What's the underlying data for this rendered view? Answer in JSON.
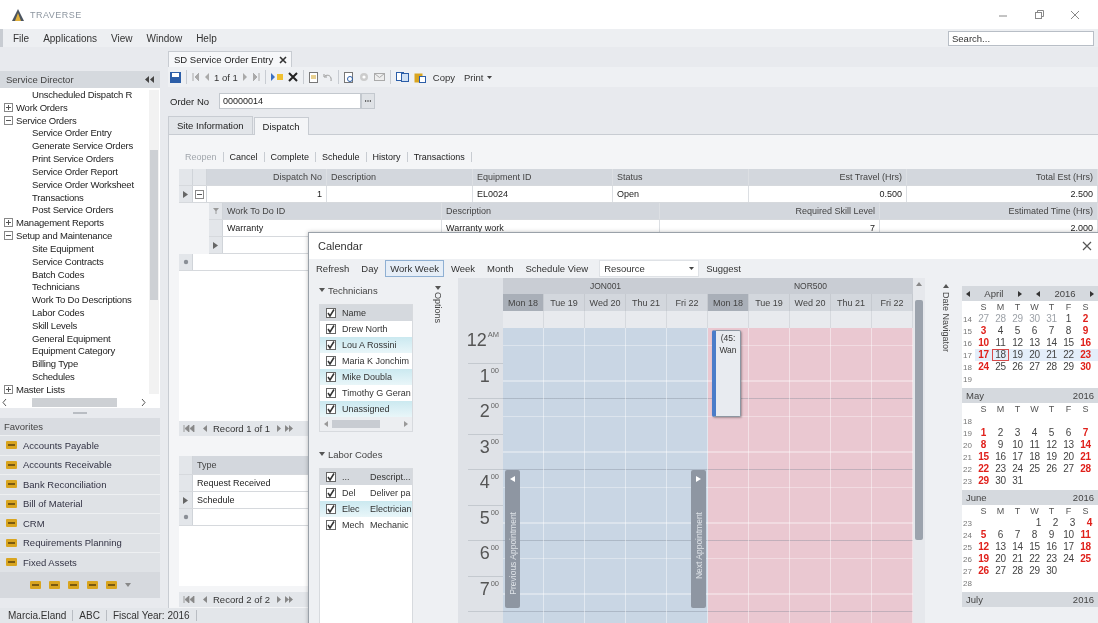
{
  "app": {
    "title": "TRAVERSE"
  },
  "menu": [
    "File",
    "Applications",
    "View",
    "Window",
    "Help"
  ],
  "search": {
    "placeholder": "Search..."
  },
  "sidebar": {
    "title": "Service Director",
    "tree": [
      {
        "label": "Unscheduled Dispatch R",
        "kind": "leaf"
      },
      {
        "label": "Work Orders",
        "kind": "node",
        "expanded": false
      },
      {
        "label": "Service Orders",
        "kind": "node",
        "expanded": true,
        "children": [
          {
            "label": "Service Order Entry",
            "kind": "leaf"
          },
          {
            "label": "Generate Service Orders",
            "kind": "leaf"
          },
          {
            "label": "Print Service Orders",
            "kind": "leaf"
          },
          {
            "label": "Service Order Report",
            "kind": "leaf"
          },
          {
            "label": "Service Order Worksheet",
            "kind": "leaf"
          },
          {
            "label": "Transactions",
            "kind": "leaf"
          },
          {
            "label": "Post Service Orders",
            "kind": "leaf"
          }
        ]
      },
      {
        "label": "Management Reports",
        "kind": "node",
        "expanded": false
      },
      {
        "label": "Setup and Maintenance",
        "kind": "node",
        "expanded": true,
        "children": [
          {
            "label": "Site Equipment",
            "kind": "leaf"
          },
          {
            "label": "Service Contracts",
            "kind": "leaf"
          },
          {
            "label": "Batch Codes",
            "kind": "leaf"
          },
          {
            "label": "Technicians",
            "kind": "leaf"
          },
          {
            "label": "Work To Do Descriptions",
            "kind": "leaf"
          },
          {
            "label": "Labor Codes",
            "kind": "leaf"
          },
          {
            "label": "Skill Levels",
            "kind": "leaf"
          },
          {
            "label": "General Equipment",
            "kind": "leaf"
          },
          {
            "label": "Equipment Category",
            "kind": "leaf"
          },
          {
            "label": "Billing Type",
            "kind": "leaf"
          },
          {
            "label": "Schedules",
            "kind": "leaf"
          }
        ]
      },
      {
        "label": "Master Lists",
        "kind": "node",
        "expanded": false
      }
    ],
    "favorites_title": "Favorites",
    "favorites": [
      "Accounts Payable",
      "Accounts Receivable",
      "Bank Reconciliation",
      "Bill of Material",
      "CRM",
      "Requirements Planning",
      "Fixed Assets"
    ]
  },
  "document_tab": {
    "label": "SD Service Order Entry"
  },
  "toolbar": {
    "record": "1 of 1",
    "copy": "Copy",
    "print": "Print"
  },
  "order": {
    "label": "Order No",
    "value": "00000014"
  },
  "tabs": [
    {
      "label": "Site Information",
      "selected": false
    },
    {
      "label": "Dispatch",
      "selected": true
    }
  ],
  "actions": [
    {
      "label": "Reopen",
      "disabled": true
    },
    {
      "label": "Cancel",
      "disabled": false
    },
    {
      "label": "Complete",
      "disabled": false
    },
    {
      "label": "Schedule",
      "disabled": false
    },
    {
      "label": "History",
      "disabled": false
    },
    {
      "label": "Transactions",
      "disabled": false
    }
  ],
  "dispatch_grid": {
    "columns": [
      "Dispatch No",
      "Description",
      "Equipment ID",
      "Status",
      "Est Travel (Hrs)",
      "Total Est (Hrs)"
    ],
    "rows": [
      {
        "current": true,
        "expanded": true,
        "cells": [
          "1",
          null,
          "EL0024",
          "Open",
          "0.500",
          "2.500"
        ]
      }
    ]
  },
  "work_grid": {
    "columns": [
      "Work To Do ID",
      "Description",
      "Required Skill Level",
      "Estimated Time (Hrs)"
    ],
    "rows": [
      {
        "current": false,
        "cells": [
          "Warranty",
          "Warranty work",
          "7",
          "2.000"
        ]
      }
    ],
    "entry_row_current": true
  },
  "record_nav_top": "Record 1 of 1",
  "type_grid": {
    "column": "Type",
    "rows": [
      {
        "text": "Request Received",
        "current": false
      },
      {
        "text": "Schedule",
        "current": true
      }
    ]
  },
  "record_nav_bottom": "Record 2 of 2",
  "status_bar": [
    "Marcia.Eland",
    "ABC",
    "Fiscal Year: 2016"
  ],
  "calendar": {
    "title": "Calendar",
    "views": [
      {
        "label": "Refresh",
        "selected": false
      },
      {
        "label": "Day",
        "selected": false
      },
      {
        "label": "Work Week",
        "selected": true
      },
      {
        "label": "Week",
        "selected": false
      },
      {
        "label": "Month",
        "selected": false
      },
      {
        "label": "Schedule View",
        "selected": false
      }
    ],
    "resource_select": "Resource",
    "suggest": "Suggest",
    "technicians": {
      "title": "Technicians",
      "header": "Name",
      "header_checked": true,
      "rows": [
        {
          "name": "Drew North",
          "checked": true,
          "selected": false
        },
        {
          "name": "Lou A Rossini",
          "checked": true,
          "selected": true
        },
        {
          "name": "Maria K Jonchim",
          "checked": true,
          "selected": false
        },
        {
          "name": "Mike Doubla",
          "checked": true,
          "selected": true
        },
        {
          "name": "Timothy G Geran",
          "checked": true,
          "selected": false
        },
        {
          "name": "Unassigned",
          "checked": true,
          "selected": true
        }
      ]
    },
    "labor_codes": {
      "title": "Labor Codes",
      "header_code": "...",
      "header_description": "Descript...",
      "header_checked": true,
      "rows": [
        {
          "code": "Del",
          "description": "Deliver pa",
          "checked": true,
          "selected": false
        },
        {
          "code": "Elec",
          "description": "Electrician",
          "checked": true,
          "selected": true
        },
        {
          "code": "Mech",
          "description": "Mechanic",
          "checked": true,
          "selected": false
        }
      ]
    },
    "options_label": "Options",
    "resources": [
      {
        "name": "JON001",
        "color": "#c9d6e4",
        "days": [
          {
            "label": "Mon 18",
            "selected": true
          },
          {
            "label": "Tue 19",
            "selected": false
          },
          {
            "label": "Wed 20",
            "selected": false
          },
          {
            "label": "Thu 21",
            "selected": false
          },
          {
            "label": "Fri 22",
            "selected": false
          }
        ]
      },
      {
        "name": "NOR500",
        "color": "#eac8d1",
        "days": [
          {
            "label": "Mon 18",
            "selected": true,
            "appointment": {
              "lines": [
                "(45:",
                "Wan"
              ]
            }
          },
          {
            "label": "Tue 19",
            "selected": false
          },
          {
            "label": "Wed 20",
            "selected": false
          },
          {
            "label": "Thu 21",
            "selected": false
          },
          {
            "label": "Fri 22",
            "selected": false
          }
        ]
      }
    ],
    "hours": [
      {
        "hour": "12",
        "suffix": "AM"
      },
      {
        "hour": "1",
        "suffix": "00"
      },
      {
        "hour": "2",
        "suffix": "00"
      },
      {
        "hour": "3",
        "suffix": "00"
      },
      {
        "hour": "4",
        "suffix": "00"
      },
      {
        "hour": "5",
        "suffix": "00"
      },
      {
        "hour": "6",
        "suffix": "00"
      },
      {
        "hour": "7",
        "suffix": "00"
      }
    ],
    "prev_label": "Previous Appointment",
    "next_label": "Next Appointment",
    "navigator_label": "Date Navigator",
    "months": [
      {
        "name": "April",
        "year": "2016",
        "kind": "nav",
        "weekdays": [
          "S",
          "M",
          "T",
          "W",
          "T",
          "F",
          "S"
        ],
        "weeks": [
          {
            "number": "14",
            "kind": "start",
            "highlighted": false,
            "days": [
              {
                "t": "27",
                "kind": "other",
                "selected": false
              },
              {
                "t": "28",
                "kind": "other",
                "selected": false
              },
              {
                "t": "29",
                "kind": "other",
                "selected": false
              },
              {
                "t": "30",
                "kind": "other",
                "selected": false
              },
              {
                "t": "31",
                "kind": "other",
                "selected": false
              },
              {
                "t": "1",
                "kind": "weekday",
                "selected": false
              },
              {
                "t": "2",
                "kind": "weekend",
                "selected": false
              }
            ]
          },
          {
            "number": "15",
            "kind": "start",
            "highlighted": false,
            "days": [
              {
                "t": "3",
                "kind": "weekend",
                "selected": false
              },
              {
                "t": "4",
                "kind": "weekday",
                "selected": false
              },
              {
                "t": "5",
                "kind": "weekday",
                "selected": false
              },
              {
                "t": "6",
                "kind": "weekday",
                "selected": false
              },
              {
                "t": "7",
                "kind": "weekday",
                "selected": false
              },
              {
                "t": "8",
                "kind": "weekday",
                "selected": false
              },
              {
                "t": "9",
                "kind": "weekend",
                "selected": false
              }
            ]
          },
          {
            "number": "16",
            "kind": "start",
            "highlighted": false,
            "days": [
              {
                "t": "10",
                "kind": "weekend",
                "selected": false
              },
              {
                "t": "11",
                "kind": "weekday",
                "selected": false
              },
              {
                "t": "12",
                "kind": "weekday",
                "selected": false
              },
              {
                "t": "13",
                "kind": "weekday",
                "selected": false
              },
              {
                "t": "14",
                "kind": "weekday",
                "selected": false
              },
              {
                "t": "15",
                "kind": "weekday",
                "selected": false
              },
              {
                "t": "16",
                "kind": "weekend",
                "selected": false
              }
            ]
          },
          {
            "number": "17",
            "kind": "start",
            "highlighted": true,
            "days": [
              {
                "t": "17",
                "kind": "weekend",
                "selected": false
              },
              {
                "t": "18",
                "kind": "weekday",
                "selected": true
              },
              {
                "t": "19",
                "kind": "weekday",
                "selected": false
              },
              {
                "t": "20",
                "kind": "weekday",
                "selected": false
              },
              {
                "t": "21",
                "kind": "weekday",
                "selected": false
              },
              {
                "t": "22",
                "kind": "weekday",
                "selected": false
              },
              {
                "t": "23",
                "kind": "weekend",
                "selected": false
              }
            ]
          },
          {
            "number": "18",
            "kind": "start",
            "highlighted": false,
            "days": [
              {
                "t": "24",
                "kind": "weekend",
                "selected": false
              },
              {
                "t": "25",
                "kind": "weekday",
                "selected": false
              },
              {
                "t": "26",
                "kind": "weekday",
                "selected": false
              },
              {
                "t": "27",
                "kind": "weekday",
                "selected": false
              },
              {
                "t": "28",
                "kind": "weekday",
                "selected": false
              },
              {
                "t": "29",
                "kind": "weekday",
                "selected": false
              },
              {
                "t": "30",
                "kind": "weekend",
                "selected": false
              }
            ]
          },
          {
            "number": "19",
            "kind": "start",
            "highlighted": false
          }
        ]
      },
      {
        "name": "May",
        "year": "2016",
        "kind": "plain",
        "weekdays": [
          "S",
          "M",
          "T",
          "W",
          "T",
          "F",
          "S"
        ],
        "weeks": [
          {
            "number": "18",
            "kind": "start",
            "highlighted": false
          },
          {
            "number": "19",
            "kind": "start",
            "highlighted": false,
            "days": [
              {
                "t": "1",
                "kind": "weekend",
                "selected": false
              },
              {
                "t": "2",
                "kind": "weekday",
                "selected": false
              },
              {
                "t": "3",
                "kind": "weekday",
                "selected": false
              },
              {
                "t": "4",
                "kind": "weekday",
                "selected": false
              },
              {
                "t": "5",
                "kind": "weekday",
                "selected": false
              },
              {
                "t": "6",
                "kind": "weekday",
                "selected": false
              },
              {
                "t": "7",
                "kind": "weekend",
                "selected": false
              }
            ]
          },
          {
            "number": "20",
            "kind": "start",
            "highlighted": false,
            "days": [
              {
                "t": "8",
                "kind": "weekend",
                "selected": false
              },
              {
                "t": "9",
                "kind": "weekday",
                "selected": false
              },
              {
                "t": "10",
                "kind": "weekday",
                "selected": false
              },
              {
                "t": "11",
                "kind": "weekday",
                "selected": false
              },
              {
                "t": "12",
                "kind": "weekday",
                "selected": false
              },
              {
                "t": "13",
                "kind": "weekday",
                "selected": false
              },
              {
                "t": "14",
                "kind": "weekend",
                "selected": false
              }
            ]
          },
          {
            "number": "21",
            "kind": "start",
            "highlighted": false,
            "days": [
              {
                "t": "15",
                "kind": "weekend",
                "selected": false
              },
              {
                "t": "16",
                "kind": "weekday",
                "selected": false
              },
              {
                "t": "17",
                "kind": "weekday",
                "selected": false
              },
              {
                "t": "18",
                "kind": "weekday",
                "selected": false
              },
              {
                "t": "19",
                "kind": "weekday",
                "selected": false
              },
              {
                "t": "20",
                "kind": "weekday",
                "selected": false
              },
              {
                "t": "21",
                "kind": "weekend",
                "selected": false
              }
            ]
          },
          {
            "number": "22",
            "kind": "start",
            "highlighted": false,
            "days": [
              {
                "t": "22",
                "kind": "weekend",
                "selected": false
              },
              {
                "t": "23",
                "kind": "weekday",
                "selected": false
              },
              {
                "t": "24",
                "kind": "weekday",
                "selected": false
              },
              {
                "t": "25",
                "kind": "weekday",
                "selected": false
              },
              {
                "t": "26",
                "kind": "weekday",
                "selected": false
              },
              {
                "t": "27",
                "kind": "weekday",
                "selected": false
              },
              {
                "t": "28",
                "kind": "weekend",
                "selected": false
              }
            ]
          },
          {
            "number": "23",
            "kind": "start",
            "highlighted": false,
            "days": [
              {
                "t": "29",
                "kind": "weekend",
                "selected": false
              },
              {
                "t": "30",
                "kind": "weekday",
                "selected": false
              },
              {
                "t": "31",
                "kind": "weekday",
                "selected": false
              }
            ]
          }
        ]
      },
      {
        "name": "June",
        "year": "2016",
        "kind": "plain",
        "weekdays": [
          "S",
          "M",
          "T",
          "W",
          "T",
          "F",
          "S"
        ],
        "weeks": [
          {
            "number": "23",
            "kind": "end",
            "highlighted": false,
            "days": [
              {
                "t": "1",
                "kind": "weekday",
                "selected": false
              },
              {
                "t": "2",
                "kind": "weekday",
                "selected": false
              },
              {
                "t": "3",
                "kind": "weekday",
                "selected": false
              },
              {
                "t": "4",
                "kind": "weekend",
                "selected": false
              }
            ]
          },
          {
            "number": "24",
            "kind": "start",
            "highlighted": false,
            "days": [
              {
                "t": "5",
                "kind": "weekend",
                "selected": false
              },
              {
                "t": "6",
                "kind": "weekday",
                "selected": false
              },
              {
                "t": "7",
                "kind": "weekday",
                "selected": false
              },
              {
                "t": "8",
                "kind": "weekday",
                "selected": false
              },
              {
                "t": "9",
                "kind": "weekday",
                "selected": false
              },
              {
                "t": "10",
                "kind": "weekday",
                "selected": false
              },
              {
                "t": "11",
                "kind": "weekend",
                "selected": false
              }
            ]
          },
          {
            "number": "25",
            "kind": "start",
            "highlighted": false,
            "days": [
              {
                "t": "12",
                "kind": "weekend",
                "selected": false
              },
              {
                "t": "13",
                "kind": "weekday",
                "selected": false
              },
              {
                "t": "14",
                "kind": "weekday",
                "selected": false
              },
              {
                "t": "15",
                "kind": "weekday",
                "selected": false
              },
              {
                "t": "16",
                "kind": "weekday",
                "selected": false
              },
              {
                "t": "17",
                "kind": "weekday",
                "selected": false
              },
              {
                "t": "18",
                "kind": "weekend",
                "selected": false
              }
            ]
          },
          {
            "number": "26",
            "kind": "start",
            "highlighted": false,
            "days": [
              {
                "t": "19",
                "kind": "weekend",
                "selected": false
              },
              {
                "t": "20",
                "kind": "weekday",
                "selected": false
              },
              {
                "t": "21",
                "kind": "weekday",
                "selected": false
              },
              {
                "t": "22",
                "kind": "weekday",
                "selected": false
              },
              {
                "t": "23",
                "kind": "weekday",
                "selected": false
              },
              {
                "t": "24",
                "kind": "weekday",
                "selected": false
              },
              {
                "t": "25",
                "kind": "weekend",
                "selected": false
              }
            ]
          },
          {
            "number": "27",
            "kind": "start",
            "highlighted": false,
            "days": [
              {
                "t": "26",
                "kind": "weekend",
                "selected": false
              },
              {
                "t": "27",
                "kind": "weekday",
                "selected": false
              },
              {
                "t": "28",
                "kind": "weekday",
                "selected": false
              },
              {
                "t": "29",
                "kind": "weekday",
                "selected": false
              },
              {
                "t": "30",
                "kind": "weekday",
                "selected": false
              }
            ]
          },
          {
            "number": "28",
            "kind": "start",
            "highlighted": false
          }
        ]
      },
      {
        "name": "July",
        "year": "2016",
        "kind": "plain"
      }
    ]
  }
}
